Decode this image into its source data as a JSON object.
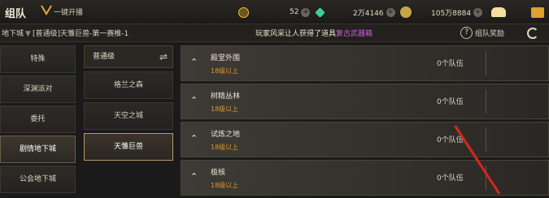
{
  "topbar": {
    "title": "组队",
    "quick_label": "一键开播",
    "currencies": [
      {
        "value": "52",
        "color": "#3bd18f"
      },
      {
        "value": "2万4146",
        "color": "#d9d2c2"
      },
      {
        "value": "105万8884",
        "color": "#e2b44b"
      }
    ],
    "currency_prefix_color": "#f0c040",
    "icon_colors": {
      "gift": "#f3dfa0",
      "mail": "#e0a030"
    }
  },
  "subbar": {
    "crumb_root": "地下城",
    "crumb_sep": "▼",
    "crumb_path": "[普通级]天雏巨兽-第一赛椎-1",
    "ticker_prefix": "玩家风采让人获得了道具",
    "ticker_item": "复古武器箱",
    "reward_label": "组队奖励",
    "reward_icon_char": "?"
  },
  "sidebar": {
    "items": [
      {
        "label": "特殊"
      },
      {
        "label": "深渊派对"
      },
      {
        "label": "委托"
      },
      {
        "label": "剧情地下城"
      },
      {
        "label": "公会地下城"
      }
    ]
  },
  "difficulty": {
    "label": "普通级",
    "swap_glyph": "⇌"
  },
  "locations": [
    {
      "label": "格兰之森"
    },
    {
      "label": "天空之城"
    },
    {
      "label": "天雏巨兽"
    }
  ],
  "dungeons": [
    {
      "name": "殿堂外围",
      "level": "18级以上",
      "count": "0个队伍"
    },
    {
      "name": "树精丛林",
      "level": "18级以上",
      "count": "0个队伍"
    },
    {
      "name": "试炼之地",
      "level": "18级以上",
      "count": "0个队伍"
    },
    {
      "name": "极核",
      "level": "18级以上",
      "count": "0个队伍"
    }
  ],
  "chevron_glyph": "⌃"
}
